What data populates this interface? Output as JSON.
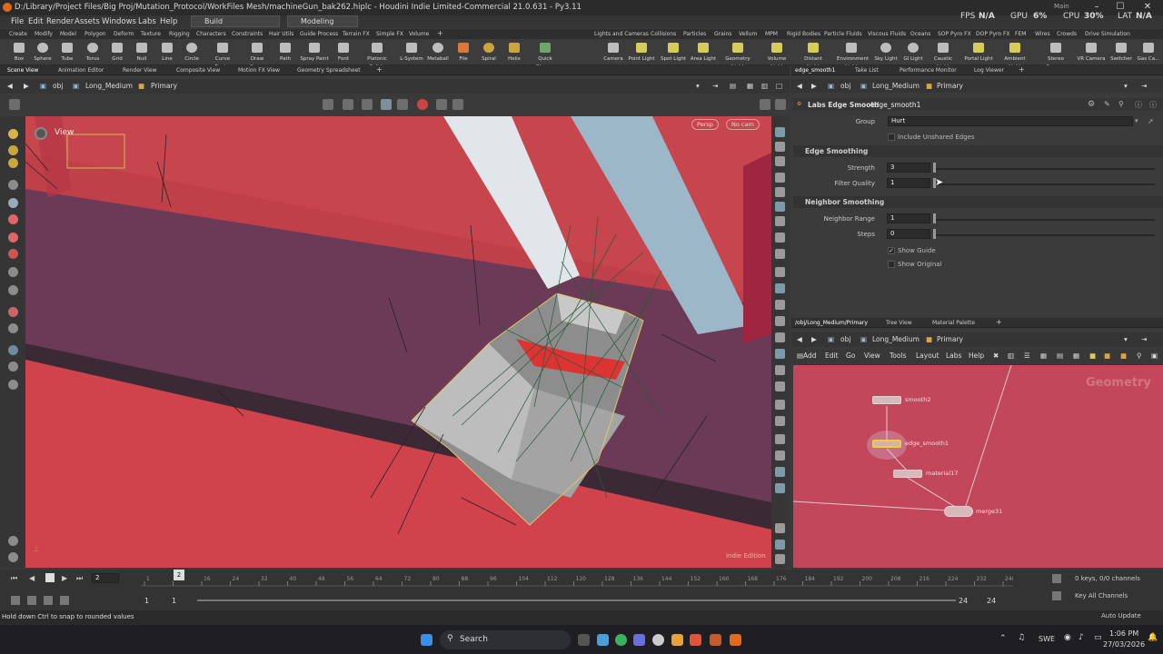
{
  "window": {
    "title": "D:/Library/Project Files/Big Proj/Mutation_Protocol/WorkFiles Mesh/machineGun_bak262.hiplc - Houdini Indie Limited-Commercial 21.0.631 - Py3.11",
    "main_label": "Main"
  },
  "menubar": {
    "items": [
      "File",
      "Edit",
      "Render",
      "Assets",
      "Windows",
      "Labs",
      "Help"
    ],
    "desktop": "Build",
    "context": "Modeling"
  },
  "stats": {
    "fps_label": "FPS",
    "fps": "N/A",
    "gpu_label": "GPU",
    "gpu": "6%",
    "cpu_label": "CPU",
    "cpu": "30%",
    "lat_label": "LAT",
    "lat": "N/A"
  },
  "shelf": {
    "left_tabs": [
      "Create",
      "Modify",
      "Model",
      "Polygon",
      "Deform",
      "Texture",
      "Rigging",
      "Characters",
      "Constraints",
      "Hair Utils",
      "Guide Process",
      "Terrain FX",
      "Simple FX",
      "Volume"
    ],
    "right_tabs": [
      "Lights and Cameras",
      "Collisions",
      "Particles",
      "Grains",
      "Vellum",
      "MPM",
      "Rigid Bodies",
      "Particle Fluids",
      "Viscous Fluids",
      "Oceans",
      "SOP Pyro FX",
      "DOP Pyro FX",
      "FEM",
      "Wires",
      "Crowds",
      "Drive Simulation"
    ],
    "left_tools": [
      "Box",
      "Sphere",
      "Tube",
      "Torus",
      "Grid",
      "Null",
      "Line",
      "Circle",
      "Curve Bezier",
      "Draw Curve",
      "Path",
      "Spray Paint",
      "Font",
      "Platonic Solids",
      "L-System",
      "Metaball",
      "File",
      "Spiral",
      "Helix",
      "Quick Shapes"
    ],
    "right_tools": [
      "Camera",
      "Point Light",
      "Spot Light",
      "Area Light",
      "Geometry Light",
      "Volume Light",
      "Distant Light",
      "Environment Light",
      "Sky Light",
      "GI Light",
      "Caustic Light",
      "Portal Light",
      "Ambient Light",
      "Stereo Camera",
      "VR Camera",
      "Switcher",
      "Gas Ca..."
    ]
  },
  "left_pane": {
    "tabs": [
      "Scene View",
      "Animation Editor",
      "Render View",
      "Composite View",
      "Motion FX View",
      "Geometry Spreadsheet"
    ],
    "path": [
      "obj",
      "Long_Medium",
      "Primary"
    ]
  },
  "viewport": {
    "label": "View",
    "camera": "Persp",
    "cam_menu": "No cam",
    "edition": "Indie Edition"
  },
  "param_pane": {
    "tabs": [
      "edge_smooth1",
      "Take List",
      "Performance Monitor",
      "Log Viewer"
    ],
    "path": [
      "obj",
      "Long_Medium",
      "Primary"
    ],
    "node_type": "Labs Edge Smooth",
    "node_name": "edge_smooth1",
    "group_label": "Group",
    "group_value": "Hurt",
    "include_unshared": "Include Unshared Edges",
    "section1": "Edge Smoothing",
    "strength_label": "Strength",
    "strength": "3",
    "filter_label": "Filter Quality",
    "filter": "1",
    "section2": "Neighbor Smoothing",
    "range_label": "Neighbor Range",
    "range": "1",
    "steps_label": "Steps",
    "steps": "0",
    "show_guide": "Show Guide",
    "show_guide_checked": true,
    "show_original": "Show Original",
    "show_original_checked": false
  },
  "net_pane": {
    "tabs": [
      "/obj/Long_Medium/Primary",
      "Tree View",
      "Material Palette"
    ],
    "path": [
      "obj",
      "Long_Medium",
      "Primary"
    ],
    "menu": [
      "Add",
      "Edit",
      "Go",
      "View",
      "Tools",
      "Layout",
      "Labs",
      "Help"
    ],
    "watermark": "Geometry",
    "nodes": [
      "smooth2",
      "edge_smooth1",
      "material17",
      "merge31"
    ]
  },
  "timeline": {
    "current": "2",
    "ticks": [
      "1",
      "8",
      "16",
      "24",
      "32",
      "40",
      "48",
      "56",
      "64",
      "72",
      "80",
      "88",
      "96",
      "104",
      "112",
      "120",
      "128",
      "136",
      "144",
      "152",
      "160",
      "168",
      "176",
      "184",
      "192",
      "200",
      "208",
      "216",
      "224",
      "232",
      "240"
    ],
    "start": "1",
    "start2": "1",
    "end": "24",
    "end2": "24",
    "keys": "0 keys, 0/0 channels",
    "key_all": "Key All Channels",
    "auto": "Auto Update"
  },
  "status": {
    "text": "Hold down Ctrl to snap to rounded values"
  },
  "taskbar": {
    "search": "Search",
    "lang": "SWE",
    "time": "1:06 PM",
    "date": "27/03/2026"
  }
}
